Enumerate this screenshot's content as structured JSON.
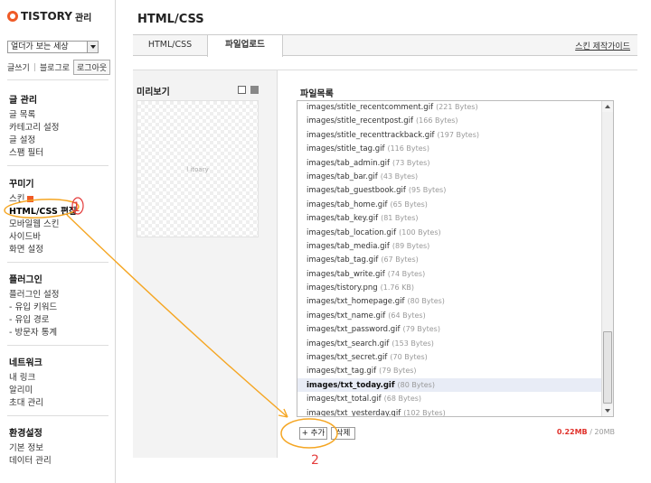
{
  "sidebar": {
    "logo_brand": "TISTORY",
    "logo_sub": "관리",
    "blog_select": "얼더가 보는 세상",
    "quick_links": {
      "write": "글쓰기",
      "sep": "|",
      "blog_home": "블로그로",
      "logout": "로그아웃"
    },
    "sections": [
      {
        "title": "글 관리",
        "items": [
          "글 목록",
          "카테고리 설정",
          "글 설정",
          "스팸 필터"
        ]
      },
      {
        "title": "꾸미기",
        "items": [
          "스킨",
          "HTML/CSS 편집",
          "모바일웹 스킨",
          "사이드바",
          "화면 설정"
        ]
      },
      {
        "title": "플러그인",
        "items": [
          "플러그인 설정",
          "- 유입 키워드",
          "- 유입 경로",
          "- 방문자 통계"
        ]
      },
      {
        "title": "네트워크",
        "items": [
          "내 링크",
          "알리미",
          "초대 관리"
        ]
      },
      {
        "title": "환경설정",
        "items": [
          "기본 정보",
          "데이터 관리"
        ]
      }
    ]
  },
  "header": {
    "title": "HTML/CSS",
    "tabs": [
      "HTML/CSS",
      "파일업로드"
    ],
    "skin_guide": "스킨 제작가이드"
  },
  "preview": {
    "title": "미리보기",
    "text": "l itoary"
  },
  "files": {
    "title": "파일목록",
    "list": [
      {
        "name": "images/stitle_recentcomment.gif",
        "size": "(221 Bytes)"
      },
      {
        "name": "images/stitle_recentpost.gif",
        "size": "(166 Bytes)"
      },
      {
        "name": "images/stitle_recenttrackback.gif",
        "size": "(197 Bytes)"
      },
      {
        "name": "images/stitle_tag.gif",
        "size": "(116 Bytes)"
      },
      {
        "name": "images/tab_admin.gif",
        "size": "(73 Bytes)"
      },
      {
        "name": "images/tab_bar.gif",
        "size": "(43 Bytes)"
      },
      {
        "name": "images/tab_guestbook.gif",
        "size": "(95 Bytes)"
      },
      {
        "name": "images/tab_home.gif",
        "size": "(65 Bytes)"
      },
      {
        "name": "images/tab_key.gif",
        "size": "(81 Bytes)"
      },
      {
        "name": "images/tab_location.gif",
        "size": "(100 Bytes)"
      },
      {
        "name": "images/tab_media.gif",
        "size": "(89 Bytes)"
      },
      {
        "name": "images/tab_tag.gif",
        "size": "(67 Bytes)"
      },
      {
        "name": "images/tab_write.gif",
        "size": "(74 Bytes)"
      },
      {
        "name": "images/tistory.png",
        "size": "(1.76 KB)"
      },
      {
        "name": "images/txt_homepage.gif",
        "size": "(80 Bytes)"
      },
      {
        "name": "images/txt_name.gif",
        "size": "(64 Bytes)"
      },
      {
        "name": "images/txt_password.gif",
        "size": "(79 Bytes)"
      },
      {
        "name": "images/txt_search.gif",
        "size": "(153 Bytes)"
      },
      {
        "name": "images/txt_secret.gif",
        "size": "(70 Bytes)"
      },
      {
        "name": "images/txt_tag.gif",
        "size": "(79 Bytes)"
      },
      {
        "name": "images/txt_today.gif",
        "size": "(80 Bytes)",
        "selected": true
      },
      {
        "name": "images/txt_total.gif",
        "size": "(68 Bytes)"
      },
      {
        "name": "images/txt_yesterday.gif",
        "size": "(102 Bytes)"
      }
    ],
    "add_button": "+ 추가",
    "delete_button": "삭제",
    "quota_used": "0.22MB",
    "quota_total": "/ 20MB"
  },
  "annotations": {
    "step1": "1",
    "step2": "2",
    "color": "#e43c3c",
    "circle_color": "#f5a623"
  },
  "colors": {
    "accent": "#ef5a26",
    "quota_used": "#e0302a",
    "selected_row": "#e8ecf6"
  }
}
